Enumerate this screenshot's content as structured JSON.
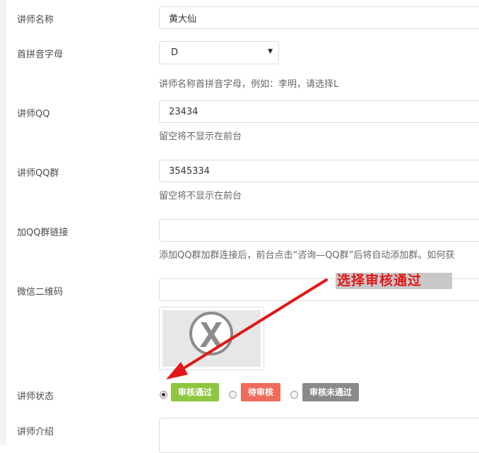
{
  "form": {
    "name": {
      "label": "讲师名称",
      "value": "黄大仙"
    },
    "pinyin": {
      "label": "首拼音字母",
      "selected": "D",
      "help": "讲师名称首拼音字母，例如：李明，请选择L"
    },
    "qq": {
      "label": "讲师QQ",
      "value": "23434",
      "help": "留空将不显示在前台"
    },
    "qq_group": {
      "label": "讲师QQ群",
      "value": "3545334",
      "help": "留空将不显示在前台"
    },
    "qq_group_link": {
      "label": "加QQ群链接",
      "value": "",
      "help": "添加QQ群加群连接后，前台点击“咨询—QQ群”后将自动添加群。如何获"
    },
    "wechat_qr": {
      "label": "微信二维码",
      "value": ""
    },
    "status": {
      "label": "讲师状态",
      "options": [
        {
          "label": "审核通过",
          "color": "#8dc63f",
          "checked": true
        },
        {
          "label": "待审核",
          "color": "#ef6b5b",
          "checked": false
        },
        {
          "label": "审核未通过",
          "color": "#8a8a8a",
          "checked": false
        }
      ]
    },
    "intro": {
      "label": "讲师介绍",
      "value": ""
    }
  },
  "annotation": {
    "text": "选择审核通过",
    "color": "#e01818"
  },
  "icons": {
    "select_arrow": "▼",
    "placeholder_image": "broken-image-x-icon"
  }
}
